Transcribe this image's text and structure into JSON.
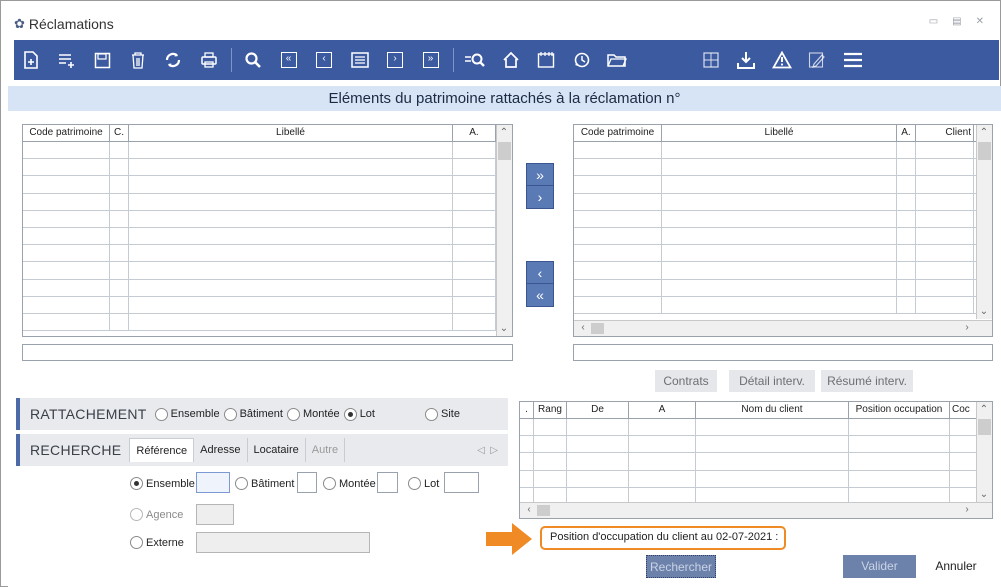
{
  "window": {
    "title": "Réclamations",
    "app_icon": "app-icon"
  },
  "toolbar": {
    "icons": [
      "add-record-icon",
      "add-line-icon",
      "save-icon",
      "delete-icon",
      "refresh-icon",
      "print-icon",
      "search-icon",
      "first-icon",
      "prev-icon",
      "list-icon",
      "next-icon",
      "last-icon",
      "search-list-icon",
      "home-icon",
      "calendar-icon",
      "history-icon",
      "folder-icon",
      "grid-icon",
      "download-icon",
      "warning-icon",
      "edit-icon",
      "menu-icon"
    ]
  },
  "dialog": {
    "title": "Eléments du patrimoine rattachés à la réclamation n°"
  },
  "left_grid": {
    "columns": [
      "Code patrimoine",
      "C.",
      "Libellé",
      "A."
    ]
  },
  "right_grid": {
    "columns": [
      "Code patrimoine",
      "Libellé",
      "A.",
      "Client"
    ]
  },
  "move_buttons": {
    "add_all": "»",
    "add_one": "›",
    "remove_one": "‹",
    "remove_all": "«"
  },
  "action_buttons": {
    "contrats": "Contrats",
    "detail": "Détail interv.",
    "resume": "Résumé interv."
  },
  "rattachement": {
    "label": "RATTACHEMENT",
    "options": [
      "Ensemble",
      "Bâtiment",
      "Montée",
      "Lot",
      "Site"
    ],
    "selected": "Lot"
  },
  "recherche": {
    "label": "RECHERCHE",
    "tabs": [
      "Référence",
      "Adresse",
      "Locataire",
      "Autre"
    ],
    "active_tab": "Référence",
    "fields": {
      "ensemble": "Ensemble",
      "batiment": "Bâtiment",
      "montee": "Montée",
      "lot": "Lot",
      "agence": "Agence",
      "externe": "Externe"
    }
  },
  "occupation_grid": {
    "columns": [
      ".",
      "Rang",
      "De",
      "A",
      "Nom du client",
      "Position occupation",
      "Coc"
    ]
  },
  "occupation_label": "Position d'occupation du client au 02-07-2021 :",
  "buttons": {
    "rechercher": "Rechercher",
    "valider": "Valider",
    "annuler": "Annuler"
  },
  "colors": {
    "toolbar": "#3c5aa0",
    "dialog_header": "#d6e4f6",
    "highlight_orange": "#f08a24"
  }
}
